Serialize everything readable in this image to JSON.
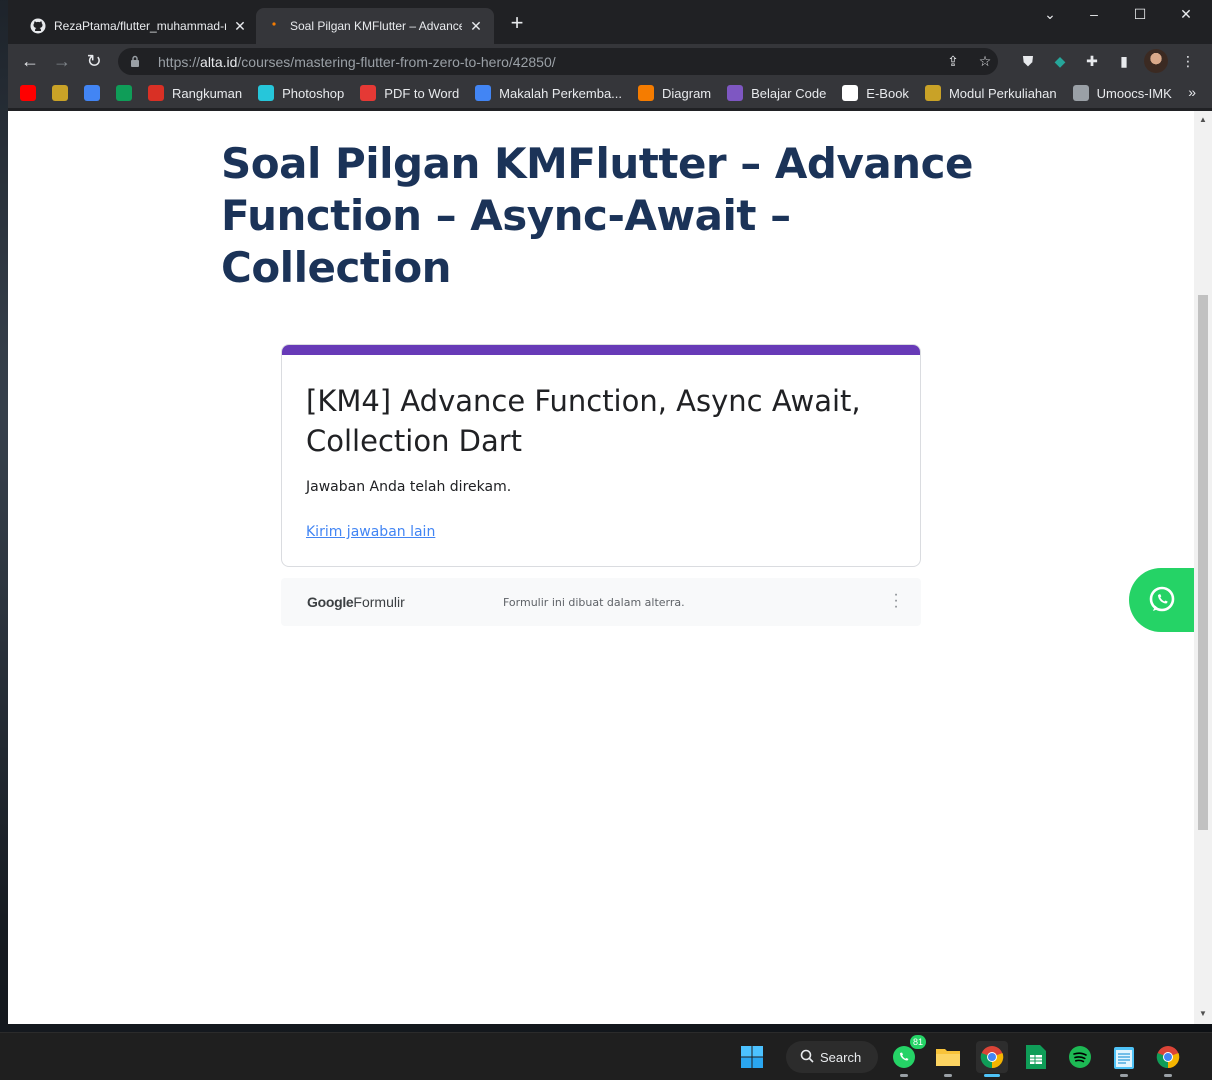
{
  "window": {
    "tabs": [
      {
        "title": "RezaPtama/flutter_muhammad-r",
        "favicon": "github-icon"
      },
      {
        "title": "Soal Pilgan KMFlutter – Advance",
        "favicon": "alta-icon"
      }
    ],
    "new_tab": "+",
    "controls": {
      "minimize": "–",
      "maximize": "☐",
      "close": "✕",
      "tabsearch": "⌄"
    }
  },
  "toolbar": {
    "url_scheme": "https://",
    "url_host": "alta.id",
    "url_path": "/courses/mastering-flutter-from-zero-to-hero/42850/"
  },
  "bookmarks": [
    {
      "label": "",
      "icon": "youtube-icon",
      "color": "#ff0000"
    },
    {
      "label": "",
      "icon": "campus-seal-icon",
      "color": "#c9a227"
    },
    {
      "label": "",
      "icon": "google-translate-icon",
      "color": "#4285f4"
    },
    {
      "label": "",
      "icon": "sheets-plus-icon",
      "color": "#0f9d58"
    },
    {
      "label": "Rangkuman",
      "icon": "cloud-icon",
      "color": "#d93025"
    },
    {
      "label": "Photoshop",
      "icon": "photoshop-icon",
      "color": "#26c6da"
    },
    {
      "label": "PDF to Word",
      "icon": "heart-icon",
      "color": "#e53935"
    },
    {
      "label": "Makalah Perkemba...",
      "icon": "docs-icon",
      "color": "#4285f4"
    },
    {
      "label": "Diagram",
      "icon": "diagram-icon",
      "color": "#f57c00"
    },
    {
      "label": "Belajar Code",
      "icon": "bolt-icon",
      "color": "#7e57c2"
    },
    {
      "label": "E-Book",
      "icon": "v-icon",
      "color": "#ffffff"
    },
    {
      "label": "Modul Perkuliahan",
      "icon": "campus-seal-icon",
      "color": "#c9a227"
    },
    {
      "label": "Umoocs-IMK",
      "icon": "globe-icon",
      "color": "#9aa0a6"
    }
  ],
  "page": {
    "title": "Soal Pilgan KMFlutter – Advance Function – Async-Await – Collection"
  },
  "form": {
    "accent_color": "#673ab7",
    "title": "[KM4]  Advance Function, Async Await, Collection Dart",
    "message": "Jawaban Anda telah direkam.",
    "resubmit_link": "Kirim jawaban lain",
    "footer_brand_google": "Google",
    "footer_brand_forms": "Formulir",
    "footer_note": "Formulir ini dibuat dalam alterra."
  },
  "taskbar": {
    "search_label": "Search",
    "whatsapp_badge": "81"
  }
}
